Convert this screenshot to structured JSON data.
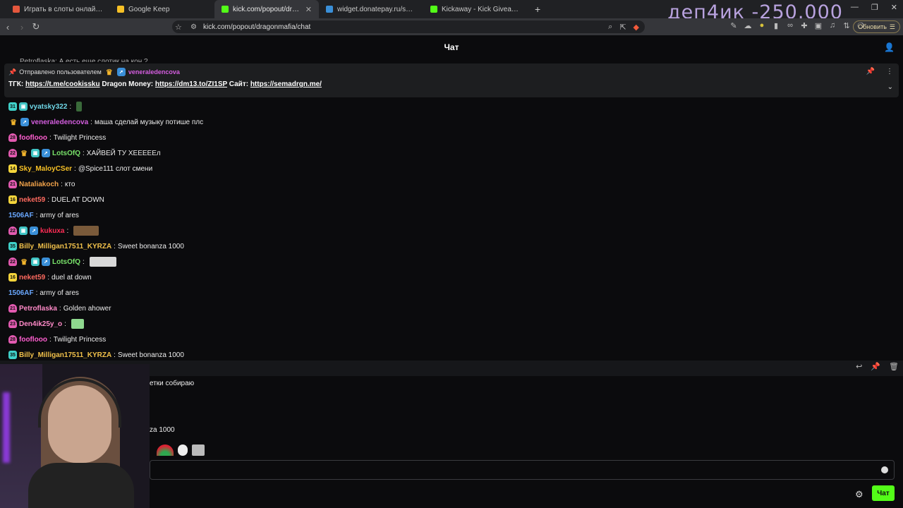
{
  "browser": {
    "tabs": [
      {
        "title": "Играть в слоты онлайн в казино",
        "color": "#e4573d",
        "active": false
      },
      {
        "title": "Google Keep",
        "color": "#f6c026",
        "active": false
      },
      {
        "title": "kick.com/popout/dragonmafia/ch",
        "color": "#53fc18",
        "active": true
      },
      {
        "title": "widget.donatepay.ru/showplayer",
        "color": "#3a8fd8",
        "active": false
      },
      {
        "title": "Kickaway - Kick Giveaway Tool",
        "color": "#53fc18",
        "active": false
      }
    ],
    "url": "kick.com/popout/dragonmafia/chat",
    "update_label": "Обновить"
  },
  "overlay_text": "деп4ик -250.000",
  "chat": {
    "header_title": "Чат",
    "partial_top": "Petroflaska: А есть еще слотик на кон ?",
    "pinned": {
      "sent_by_label": "Отправлено пользователем",
      "sender": "veneraledencova",
      "parts": [
        {
          "t": "ТГК: ",
          "link": false
        },
        {
          "t": "https://t.me/cookissku",
          "link": true
        },
        {
          "t": " Dragon Money: ",
          "link": false
        },
        {
          "t": "https://dm13.to/ZI1SP",
          "link": true
        },
        {
          "t": " Сайт: ",
          "link": false
        },
        {
          "t": "https://semadrgn.me/",
          "link": true
        }
      ]
    },
    "messages": [
      {
        "badges": [
          {
            "k": "b-teal",
            "t": "31"
          },
          {
            "k": "b-mod",
            "t": "▣"
          }
        ],
        "user": "vyatsky322",
        "color": "#6fd8e8",
        "text": "",
        "emote": {
          "w": 8,
          "c": "#3a6a3a"
        }
      },
      {
        "badges": [
          {
            "k": "b-crown",
            "t": "♛"
          },
          {
            "k": "b-blue",
            "t": "➚"
          }
        ],
        "user": "veneraledencova",
        "color": "#d55ee0",
        "text": "маша сделай музыку потише плс"
      },
      {
        "badges": [
          {
            "k": "b-pink",
            "t": "28"
          }
        ],
        "user": "fooflooo",
        "color": "#ff5fd0",
        "text": "Twilight Princess"
      },
      {
        "badges": [
          {
            "k": "b-pink",
            "t": "22"
          },
          {
            "k": "b-crown",
            "t": "♛"
          },
          {
            "k": "b-mod",
            "t": "▣"
          },
          {
            "k": "b-blue",
            "t": "➚"
          }
        ],
        "user": "LotsOfQ",
        "color": "#79e36a",
        "text": "ХАЙВЕЙ ТУ ХЕЕЕЕЕл"
      },
      {
        "badges": [
          {
            "k": "b-sub",
            "t": "14"
          }
        ],
        "user": "Sky_MaloyCSer",
        "color": "#f6c026",
        "text": "@Spice111 слот смени"
      },
      {
        "badges": [
          {
            "k": "b-pink",
            "t": "21"
          }
        ],
        "user": "Nataliakoch",
        "color": "#f0a24a",
        "text": "кто"
      },
      {
        "badges": [
          {
            "k": "b-sub",
            "t": "16"
          }
        ],
        "user": "neket59",
        "color": "#ff6a5f",
        "text": "DUEL AT DOWN"
      },
      {
        "badges": [],
        "user": "1506AF",
        "color": "#6aa8ff",
        "text": "army of ares"
      },
      {
        "badges": [
          {
            "k": "b-pink",
            "t": "22"
          },
          {
            "k": "b-mod",
            "t": "▣"
          },
          {
            "k": "b-blue",
            "t": "➚"
          }
        ],
        "user": "kukuxa",
        "color": "#ff2d55",
        "text": "",
        "emote": {
          "w": 36,
          "c": "#7a5a3a"
        }
      },
      {
        "badges": [
          {
            "k": "b-teal",
            "t": "35"
          }
        ],
        "user": "Billy_Milligan17511_KYRZA",
        "color": "#f0c04a",
        "text": "Sweet bonanza 1000"
      },
      {
        "badges": [
          {
            "k": "b-pink",
            "t": "22"
          },
          {
            "k": "b-crown",
            "t": "♛"
          },
          {
            "k": "b-mod",
            "t": "▣"
          },
          {
            "k": "b-blue",
            "t": "➚"
          }
        ],
        "user": "LotsOfQ",
        "color": "#79e36a",
        "text": "",
        "emote": {
          "w": 38,
          "c": "#d8d8d8"
        }
      },
      {
        "badges": [
          {
            "k": "b-sub",
            "t": "16"
          }
        ],
        "user": "neket59",
        "color": "#ff6a5f",
        "text": "duel at down"
      },
      {
        "badges": [],
        "user": "1506AF",
        "color": "#6aa8ff",
        "text": "army of ares"
      },
      {
        "badges": [
          {
            "k": "b-pink",
            "t": "21"
          }
        ],
        "user": "Petroflaska",
        "color": "#ff8ac8",
        "text": "Golden ahower"
      },
      {
        "badges": [
          {
            "k": "b-pink",
            "t": "23"
          }
        ],
        "user": "Den4ik25y_o",
        "color": "#ff8ac8",
        "text": "",
        "emote": {
          "w": 18,
          "c": "#8fd88f"
        }
      },
      {
        "badges": [
          {
            "k": "b-pink",
            "t": "28"
          }
        ],
        "user": "fooflooo",
        "color": "#ff5fd0",
        "text": "Twilight Princess"
      },
      {
        "badges": [
          {
            "k": "b-teal",
            "t": "35"
          }
        ],
        "user": "Billy_Milligan17511_KYRZA",
        "color": "#f0c04a",
        "text": "Sweet bonanza 1000"
      }
    ],
    "lower_visible": {
      "line1": "етки собираю",
      "line2": "za 1000"
    },
    "send_label": "Чат"
  }
}
